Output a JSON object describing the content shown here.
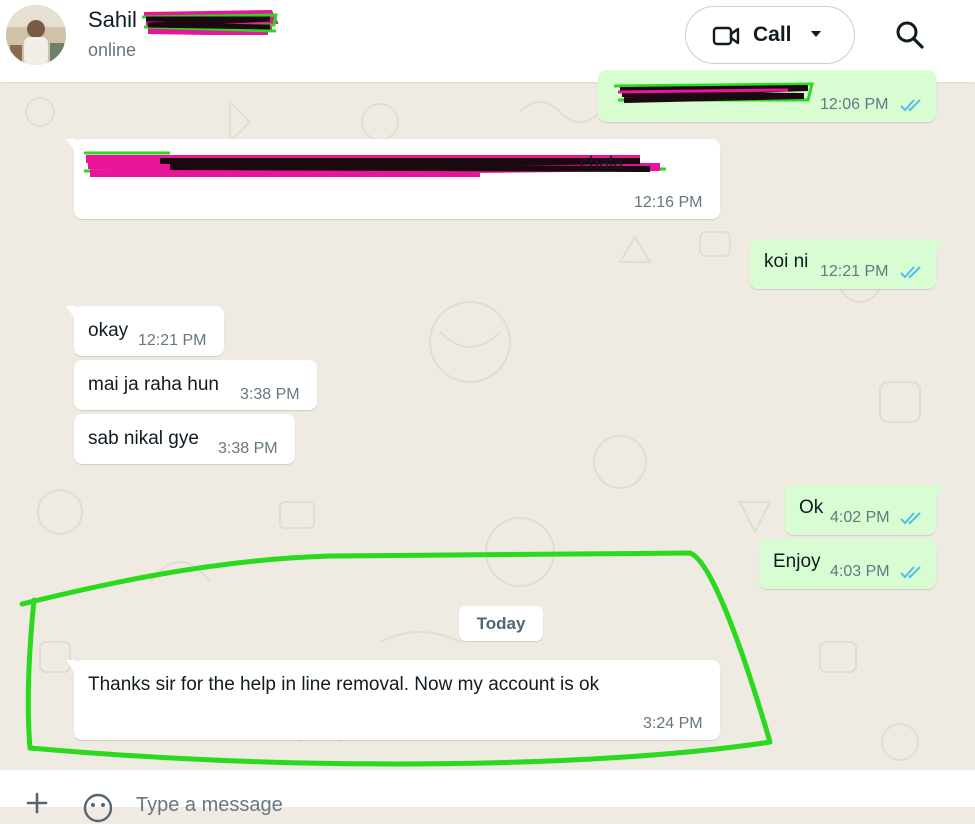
{
  "header": {
    "contact_name": "Sahil",
    "status": "online",
    "call_label": "Call"
  },
  "messages": [
    {
      "dir": "out",
      "text": "",
      "time": "12:06 PM",
      "redacted": true
    },
    {
      "dir": "in",
      "text": "",
      "time": "12:16 PM",
      "redacted": true
    },
    {
      "dir": "out",
      "text": "koi ni",
      "time": "12:21 PM"
    },
    {
      "dir": "in",
      "text": "okay",
      "time": "12:21 PM"
    },
    {
      "dir": "in",
      "text": "mai ja raha hun",
      "time": "3:38 PM"
    },
    {
      "dir": "in",
      "text": "sab nikal gye",
      "time": "3:38 PM"
    },
    {
      "dir": "out",
      "text": "Ok",
      "time": "4:02 PM"
    },
    {
      "dir": "out",
      "text": "Enjoy",
      "time": "4:03 PM"
    },
    {
      "dir": "in",
      "text": "Thanks sir for the help in line removal. Now my account is ok",
      "time": "3:24 PM"
    }
  ],
  "date_divider": "Today",
  "composer": {
    "placeholder": "Type a message"
  },
  "colors": {
    "incoming": "#ffffff",
    "outgoing": "#d9fdd3",
    "read_ticks": "#53bdeb",
    "annotation": "#2bd91e",
    "redaction_pink": "#e8149a",
    "wallpaper": "#efeae2"
  },
  "icons": [
    "avatar",
    "video-call-icon",
    "chevron-down-icon",
    "search-icon",
    "double-check-icon",
    "plus-icon",
    "emoji-icon"
  ]
}
